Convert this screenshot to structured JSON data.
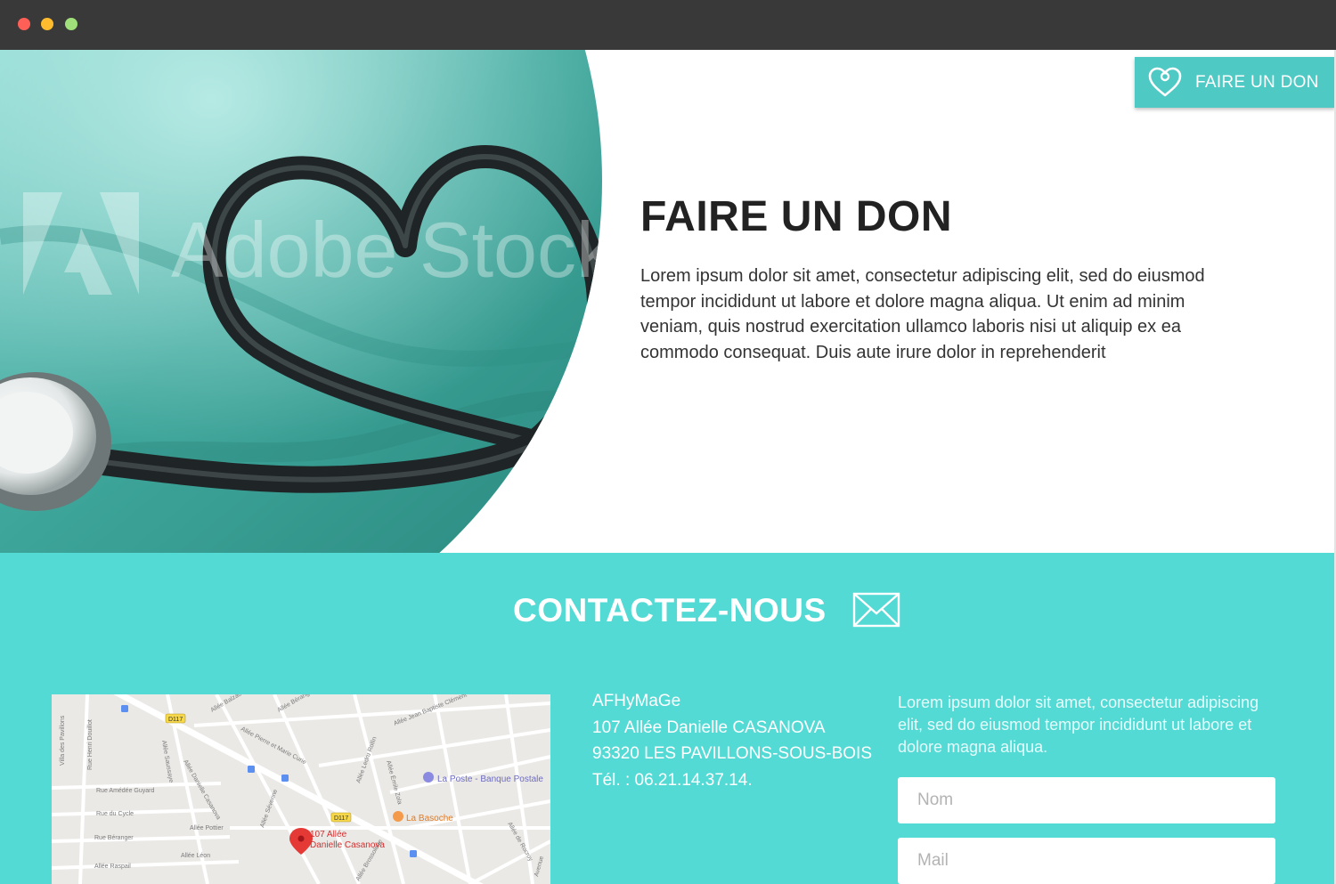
{
  "window": {
    "buttons": [
      "close",
      "minimize",
      "maximize"
    ],
    "colors": {
      "close": "#fe5f57",
      "minimize": "#febc2e",
      "maximize": "#9fe07a"
    }
  },
  "hero": {
    "image_watermark": "Adobe Stock",
    "title": "FAIRE UN DON",
    "text": "Lorem ipsum dolor sit amet, consectetur adipiscing elit, sed do eiusmod tempor incididunt ut labore et dolore magna aliqua. Ut enim ad minim veniam, quis nostrud exercitation ullamco laboris nisi ut aliquip ex ea commodo consequat. Duis aute irure dolor in reprehenderit"
  },
  "donate_button": {
    "label": "FAIRE UN DON",
    "icon": "heart-icon"
  },
  "contact": {
    "title": "CONTACTEZ-NOUS",
    "icon": "envelope-icon",
    "address": {
      "org": "AFHyMaGe",
      "street": "107 Allée Danielle CASANOVA",
      "city": "93320 LES PAVILLONS-SOUS-BOIS",
      "phone": "Tél. : 06.21.14.37.14."
    },
    "intro": "Lorem ipsum dolor sit amet, consectetur adipiscing elit, sed do eiusmod tempor incididunt ut labore et dolore magna aliqua.",
    "form": {
      "name_placeholder": "Nom",
      "mail_placeholder": "Mail"
    },
    "map": {
      "marker_label_line1": "107 Allée",
      "marker_label_line2": "Danielle Casanova",
      "poi_post": "La Poste - Banque Postale",
      "poi_restaurant": "La Basoche",
      "road_badges": [
        "D117",
        "D117"
      ],
      "streets": [
        "Villa des Pavillons",
        "Rue Henri Douillot",
        "Allée Balzac",
        "Allée Béranger",
        "Allée Jean Baptiste Clément",
        "Allée Pierre et Marie Curie",
        "Allée Ledru Rollin",
        "Allée Émile Zola",
        "Allée Saussaye",
        "Allée Danielle Casanova",
        "Rue Amédée Guyard",
        "Rue du Cycle",
        "Allée Pottier",
        "Rue Béranger",
        "Allée Raspail",
        "Allée Léon",
        "Allée Séverine",
        "Allée Brossolette",
        "Allée de Rocroy",
        "Avenue"
      ]
    },
    "colors": {
      "band": "#54dad5",
      "button": "#4fc9c4"
    }
  }
}
